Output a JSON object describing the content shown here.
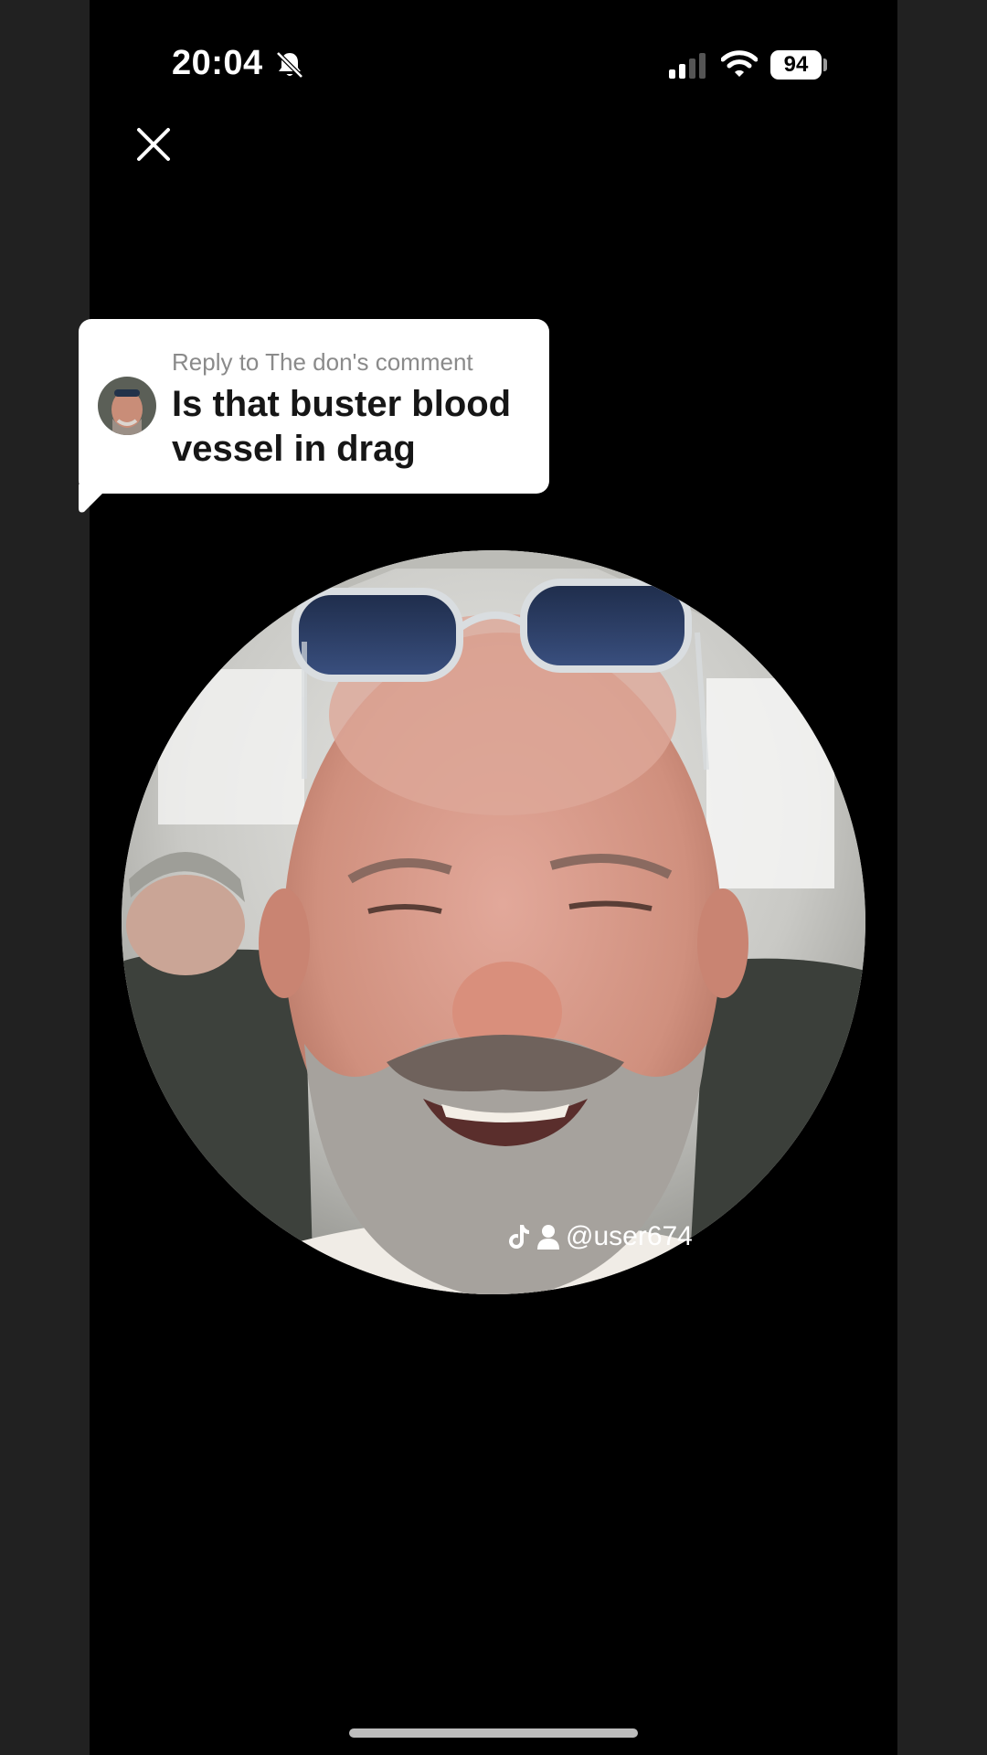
{
  "status_bar": {
    "time": "20:04",
    "battery": "94",
    "icons": [
      "bell-off-icon",
      "signal-icon",
      "wifi-icon",
      "battery-icon"
    ]
  },
  "comment_bubble": {
    "reply_label": "Reply to The don's comment",
    "comment_text": "Is that buster blood vessel in drag"
  },
  "video": {
    "watermark_handle": "@user674",
    "watermark_icons": [
      "tiktok-icon",
      "person-icon"
    ]
  },
  "colors": {
    "background": "#000000",
    "side_bars": "#212121",
    "bubble": "#ffffff",
    "reply_label": "#8a8a8a",
    "comment_text": "#161616"
  }
}
